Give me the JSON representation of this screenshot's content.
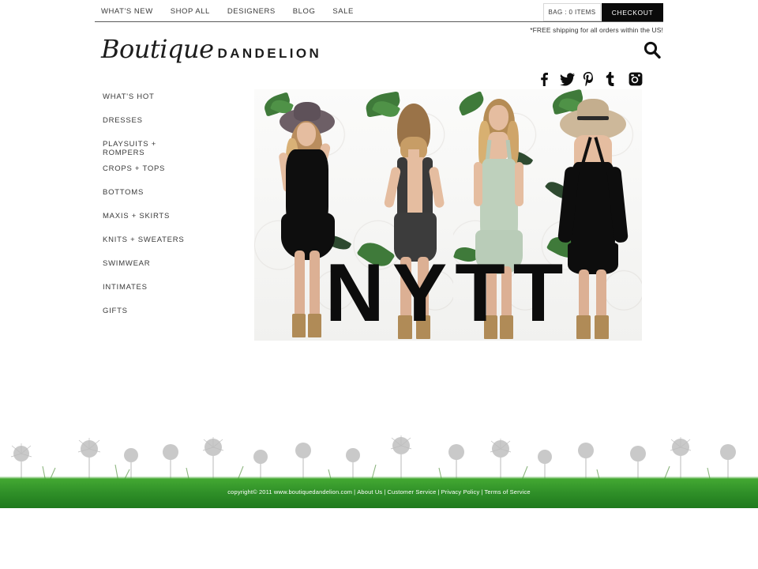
{
  "topbar": {
    "nav": [
      {
        "label": "WHAT'S NEW"
      },
      {
        "label": "SHOP ALL"
      },
      {
        "label": "DESIGNERS"
      },
      {
        "label": "BLOG"
      },
      {
        "label": "SALE"
      }
    ],
    "bag_label": "BAG : 0 ITEMS",
    "bag_count": "0",
    "checkout_label": "CHECKOUT",
    "shipping_note": "*FREE shipping for all orders within the US!"
  },
  "logo": {
    "script": "Boutique",
    "word": "DANDELION"
  },
  "search": {
    "icon": "search-icon"
  },
  "social": [
    {
      "name": "facebook-icon",
      "label": "f"
    },
    {
      "name": "twitter-icon",
      "label": "Twitter"
    },
    {
      "name": "pinterest-icon",
      "label": "P"
    },
    {
      "name": "tumblr-icon",
      "label": "t"
    },
    {
      "name": "instagram-icon",
      "label": "Instagram"
    }
  ],
  "sidebar": {
    "items": [
      {
        "label": "WHAT'S HOT"
      },
      {
        "label": "DRESSES"
      },
      {
        "label": "PLAYSUITS +\nROMPERS"
      },
      {
        "label": "CROPS + TOPS"
      },
      {
        "label": "BOTTOMS"
      },
      {
        "label": "MAXIS + SKIRTS"
      },
      {
        "label": "KNITS + SWEATERS"
      },
      {
        "label": "SWIMWEAR"
      },
      {
        "label": "INTIMATES"
      },
      {
        "label": "GIFTS"
      }
    ]
  },
  "banner": {
    "wordmark": "NYTT",
    "panels": [
      {
        "alt": "model in black sleeveless swing dress with wide brim hat"
      },
      {
        "alt": "model back view in charcoal open-back romper"
      },
      {
        "alt": "model in sage green slip dress"
      },
      {
        "alt": "model back view in black cold-shoulder dress with straw hat"
      }
    ]
  },
  "footer": {
    "copyright": "copyright© 2011 www.boutiquedandelion.com",
    "links": [
      {
        "label": "About Us"
      },
      {
        "label": "Customer Service"
      },
      {
        "label": "Privacy Policy"
      },
      {
        "label": "Terms of Service"
      }
    ],
    "separator": "|"
  },
  "colors": {
    "accent_black": "#0a0a0a",
    "grass_green": "#2f8f28",
    "text": "#3a3a3a"
  }
}
